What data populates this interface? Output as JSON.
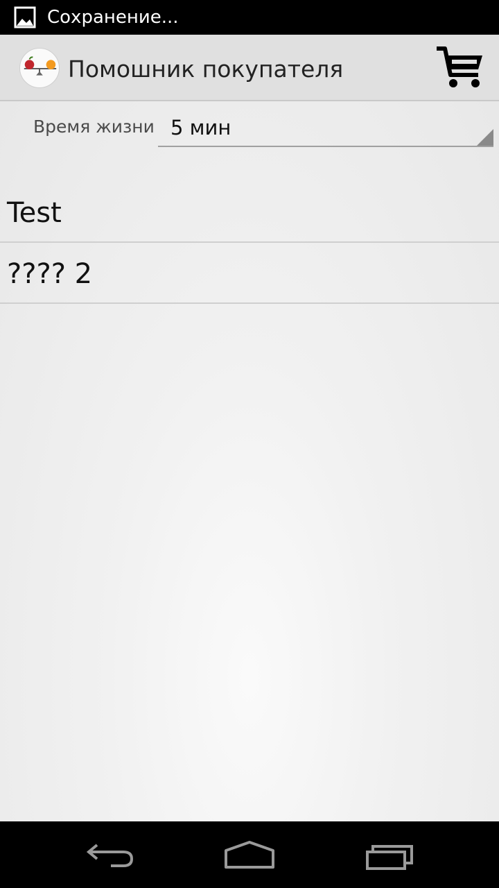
{
  "status_bar": {
    "notification_icon": "image-icon",
    "text": "Сохранение..."
  },
  "action_bar": {
    "app_icon": "scales-with-fruit-icon",
    "title": "Помошник покупателя",
    "cart_icon": "shopping-cart-icon"
  },
  "settings": {
    "ttl_label": "Время жизни",
    "ttl_value": "5 мин"
  },
  "list": {
    "items": [
      {
        "label": "Test"
      },
      {
        "label": "???? 2"
      }
    ]
  },
  "nav_bar": {
    "back_icon": "back-icon",
    "home_icon": "home-icon",
    "recents_icon": "recent-apps-icon"
  },
  "colors": {
    "status_bar_bg": "#000000",
    "action_bar_bg": "#e0e0e0",
    "content_bg": "#f2f2f2",
    "nav_bar_bg": "#000000",
    "apple_red": "#c0262d",
    "orange": "#f39a1f"
  }
}
